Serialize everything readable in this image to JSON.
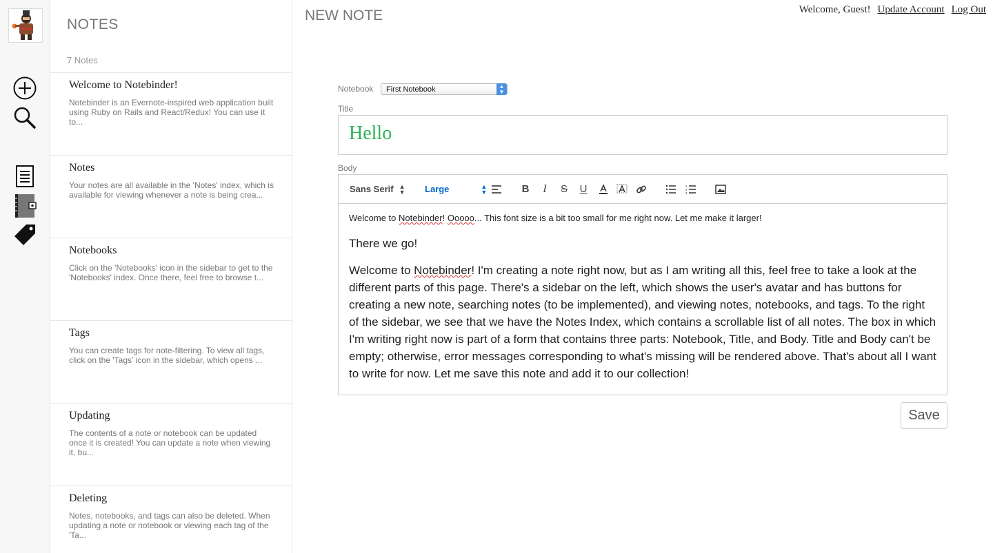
{
  "sidebar": {
    "avatar_alt": "avatar",
    "buttons": [
      "new-note",
      "search",
      "notes",
      "notebooks",
      "tags"
    ]
  },
  "index": {
    "title": "NOTES",
    "count": "7 Notes",
    "notes": [
      {
        "title": "Welcome to Notebinder!",
        "snippet": "Notebinder is an Evernote-inspired web application built using Ruby on Rails and React/Redux! You can use it to..."
      },
      {
        "title": "Notes",
        "snippet": "Your notes are all available in the 'Notes' index, which is available for viewing whenever a note is being crea..."
      },
      {
        "title": "Notebooks",
        "snippet": "Click on the 'Notebooks' icon in the sidebar to get to the 'Notebooks' index. Once there, feel free to browse t..."
      },
      {
        "title": "Tags",
        "snippet": "You can create tags for note-filtering. To view all tags, click on the 'Tags' icon in the sidebar, which opens ..."
      },
      {
        "title": "Updating",
        "snippet": "The contents of a note or notebook can be updated once it is created! You can update a note when viewing it, bu..."
      },
      {
        "title": "Deleting",
        "snippet": "Notes, notebooks, and tags can also be deleted. When updating a note or notebook or viewing each tag of the 'Ta..."
      }
    ]
  },
  "header": {
    "title": "NEW NOTE",
    "welcome": "Welcome, Guest!",
    "update_account": "Update Account",
    "logout": "Log Out"
  },
  "form": {
    "notebook_label": "Notebook",
    "notebook_value": "First Notebook",
    "title_label": "Title",
    "title_value": "Hello",
    "body_label": "Body",
    "font_value": "Sans Serif",
    "size_value": "Large",
    "body": {
      "p1_a": "Welcome to ",
      "p1_b": "Notebinder",
      "p1_c": "! ",
      "p1_d": "Ooooo",
      "p1_e": "... This font size is a bit too small for me right now. Let me make it larger!",
      "p2": "There we go!",
      "p3_a": "Welcome to ",
      "p3_b": "Notebinder",
      "p3_c": "! I'm creating a note right now, but as I am writing all this, feel free to take a look at the different parts of this page. There's a sidebar on the left, which shows the user's avatar and has buttons for creating a new note, searching notes (to be implemented), and viewing notes, notebooks, and tags. To the right of the sidebar, we see that we have the Notes Index, which contains a scrollable list of all notes. The box in which I'm writing right now is part of a form that contains three parts: Notebook, Title, and Body. Title and Body can't be empty; otherwise, error messages corresponding to what's missing will be rendered above. That's about all I want to write for now. Let me save this note and add it to our collection!"
    },
    "save_label": "Save"
  },
  "colors": {
    "title_green": "#2eb25a",
    "picker_blue": "#0066cc",
    "select_blue": "#4a90e2"
  }
}
